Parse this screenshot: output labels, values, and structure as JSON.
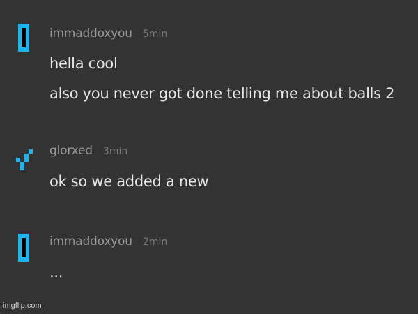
{
  "colors": {
    "background": "#333333",
    "avatar_accent": "#1fb3ec",
    "username": "#9a9a9a",
    "timestamp": "#7a7a7a",
    "message_text": "#e6e6e6"
  },
  "messages": [
    {
      "avatar_icon": "blue-bracket-avatar-icon",
      "username": "immaddoxyou",
      "timestamp": "5min",
      "lines": [
        "hella cool",
        "also you never got done telling me about balls 2"
      ]
    },
    {
      "avatar_icon": "blue-checkmark-avatar-icon",
      "username": "glorxed",
      "timestamp": "3min",
      "lines": [
        "ok so we added a new"
      ]
    },
    {
      "avatar_icon": "blue-bracket-avatar-icon",
      "username": "immaddoxyou",
      "timestamp": "2min",
      "lines": [
        "..."
      ]
    }
  ],
  "watermark": "imgflip.com"
}
